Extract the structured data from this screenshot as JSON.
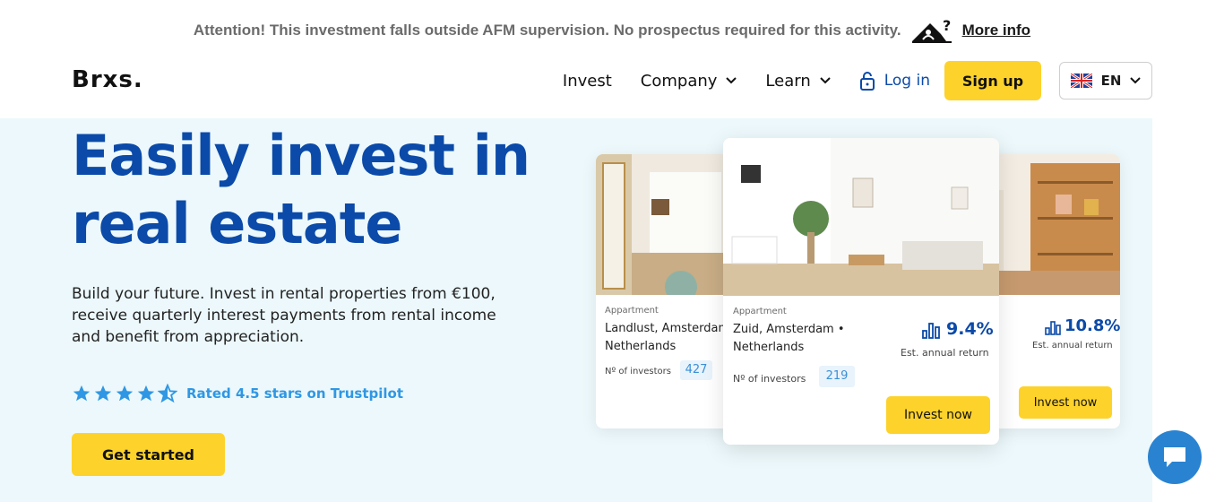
{
  "notice": {
    "text": "Attention! This investment falls outside AFM supervision. No prospectus required for this activity.",
    "link": "More info"
  },
  "brand": {
    "logo": "Brxs."
  },
  "nav": {
    "items": [
      {
        "label": "Invest"
      },
      {
        "label": "Company"
      },
      {
        "label": "Learn"
      }
    ],
    "login": "Log in",
    "signup": "Sign up",
    "language": "EN"
  },
  "hero": {
    "title_line1": "Easily invest in",
    "title_line2": "real estate",
    "text": "Build your future. Invest in rental properties from €100, receive quarterly interest payments from rental income and benefit from appreciation.",
    "rating": "Rated 4.5 stars on Trustpilot",
    "cta": "Get started"
  },
  "cards": [
    {
      "type": "Appartment",
      "location_line1": "Landlust, Amsterdam",
      "location_line2": "Netherlands",
      "investors_label": "Nº of investors",
      "investors": "427"
    },
    {
      "type": "Appartment",
      "location_line1": "Zuid, Amsterdam •",
      "location_line2": "Netherlands",
      "investors_label": "Nº of investors",
      "investors": "219",
      "return": "9.4%",
      "return_label": "Est. annual return",
      "button": "Invest now"
    },
    {
      "return": "10.8%",
      "return_label": "Est. annual return",
      "button": "Invest now"
    }
  ],
  "colors": {
    "brand_blue": "#0b4aa8",
    "accent_yellow": "#fdd22b",
    "hero_bg": "#ecf8fb",
    "trustpilot_blue": "#2f97e4"
  }
}
